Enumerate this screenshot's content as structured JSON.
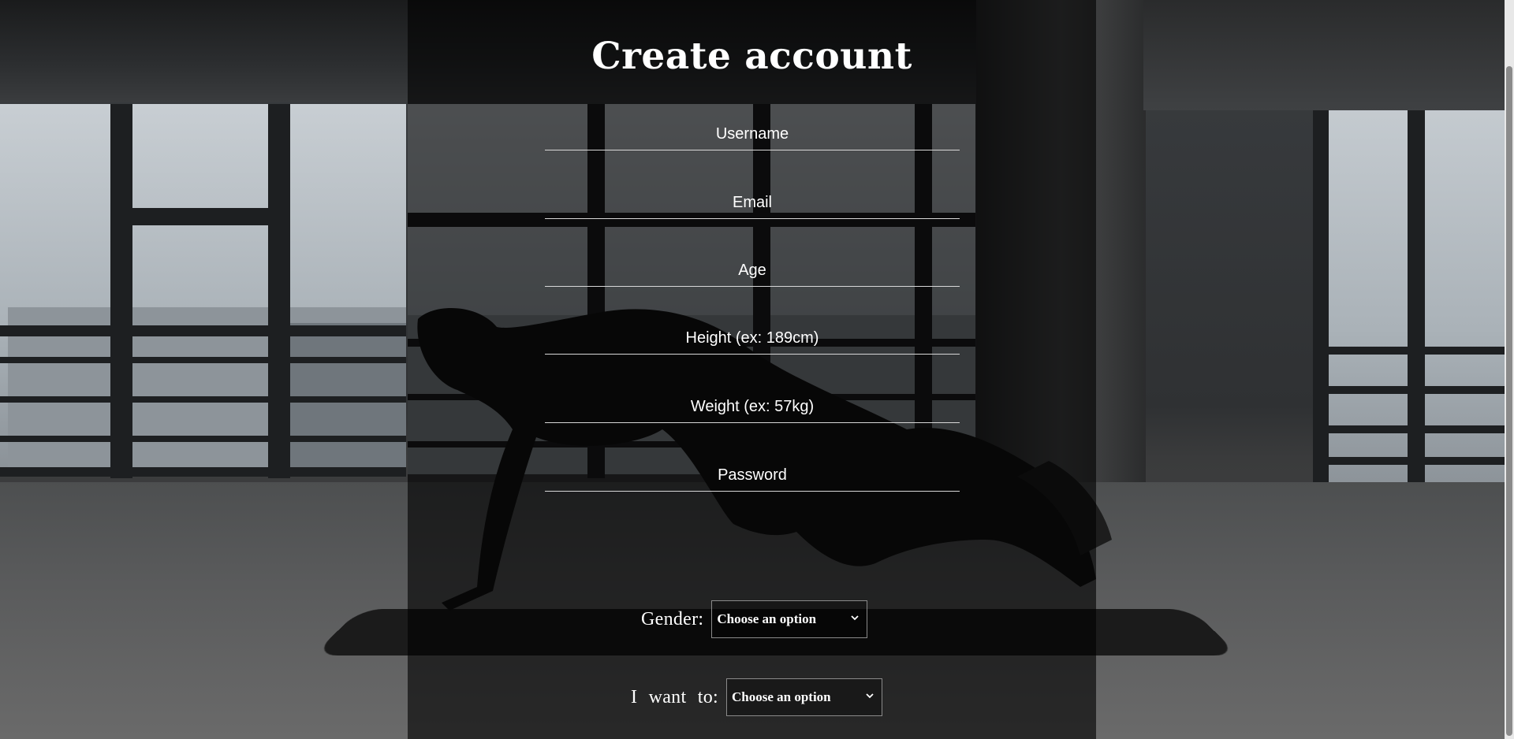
{
  "form": {
    "title": "Create account",
    "fields": {
      "username_placeholder": "Username",
      "email_placeholder": "Email",
      "age_placeholder": "Age",
      "height_placeholder": "Height (ex: 189cm)",
      "weight_placeholder": "Weight (ex: 57kg)",
      "password_placeholder": "Password"
    },
    "gender": {
      "label": "Gender:",
      "selected": "Choose an option"
    },
    "goal": {
      "label": "I want to:",
      "selected": "Choose an option"
    }
  },
  "icons": {
    "select_arrow": "chevron-down-icon"
  }
}
